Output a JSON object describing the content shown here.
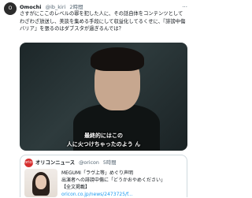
{
  "tweet": {
    "avatar_text": "O",
    "author_name": "Omochi",
    "author_handle": "@ib_kiri",
    "time": "2時間",
    "text": "さすがにここのレベルの罪を犯した人に、その話自体をコンテンツとしてわざわざ放送し、美談を集める手段にして収益化してるくせに、『誹謗中傷バリア』を張るのはダブスタが過ぎるんでは？",
    "more_label": "···"
  },
  "video": {
    "caption_line1": "最終的にはこの",
    "caption_line2": "人に火つけちゃったのよう ん"
  },
  "quote": {
    "avatar_text": "oricon",
    "author_name": "オリコンニュース",
    "author_handle": "@oricon",
    "time": "5時間",
    "line1": "MEGUMI「ラヴ上等」めぐり声明",
    "line2": "出演者への誹謗中傷に「どうかおやめください」",
    "line3": "【全文掲載】",
    "link": "oricon.co.jp/news/2473725/f..."
  }
}
